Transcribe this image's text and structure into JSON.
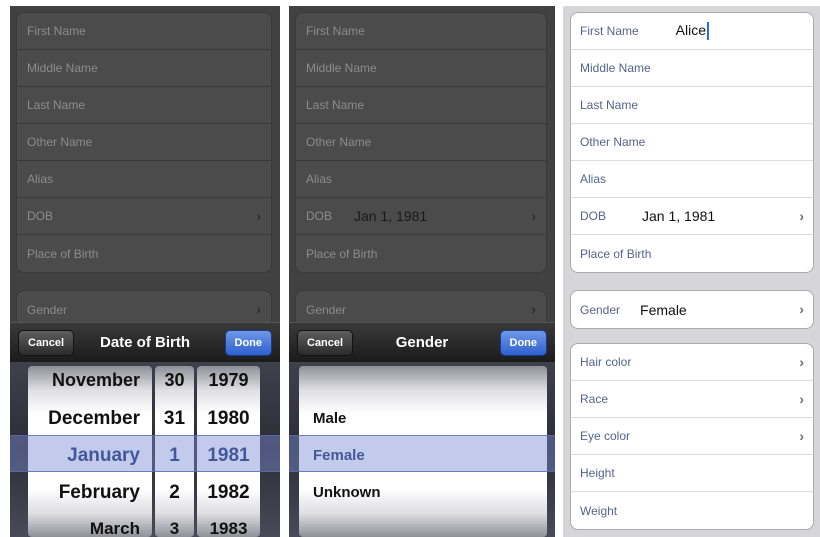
{
  "dob_screen": {
    "form": {
      "group1": [
        {
          "label": "First Name"
        },
        {
          "label": "Middle Name"
        },
        {
          "label": "Last Name"
        },
        {
          "label": "Other Name"
        },
        {
          "label": "Alias"
        },
        {
          "label": "DOB",
          "chevron": "chevron-right-icon"
        },
        {
          "label": "Place of Birth"
        }
      ],
      "gender_label": "Gender"
    },
    "toolbar": {
      "cancel": "Cancel",
      "title": "Date of Birth",
      "done": "Done"
    },
    "picker": {
      "months": [
        "November",
        "December",
        "January",
        "February",
        "March"
      ],
      "days": [
        "30",
        "31",
        "1",
        "2",
        "3"
      ],
      "years": [
        "1979",
        "1980",
        "1981",
        "1982",
        "1983"
      ],
      "selected_index": 2
    }
  },
  "gender_screen": {
    "form": {
      "group1": [
        {
          "label": "First Name"
        },
        {
          "label": "Middle Name"
        },
        {
          "label": "Last Name"
        },
        {
          "label": "Other Name"
        },
        {
          "label": "Alias"
        },
        {
          "label": "DOB",
          "value": "Jan 1, 1981",
          "chevron": "chevron-right-icon"
        },
        {
          "label": "Place of Birth"
        }
      ],
      "gender_label": "Gender"
    },
    "toolbar": {
      "cancel": "Cancel",
      "title": "Gender",
      "done": "Done"
    },
    "picker": {
      "options": [
        "Male",
        "Female",
        "Unknown"
      ],
      "selected_index": 1
    }
  },
  "form_screen": {
    "group1": [
      {
        "label": "First Name",
        "value": "Alice"
      },
      {
        "label": "Middle Name"
      },
      {
        "label": "Last Name"
      },
      {
        "label": "Other Name"
      },
      {
        "label": "Alias"
      },
      {
        "label": "DOB",
        "value": "Jan 1, 1981",
        "chevron": "chevron-right-icon"
      },
      {
        "label": "Place of Birth"
      }
    ],
    "group2": [
      {
        "label": "Gender",
        "value": "Female",
        "chevron": "chevron-right-icon"
      }
    ],
    "group3": [
      {
        "label": "Hair color",
        "chevron": "chevron-right-icon"
      },
      {
        "label": "Race",
        "chevron": "chevron-right-icon"
      },
      {
        "label": "Eye color",
        "chevron": "chevron-right-icon"
      },
      {
        "label": "Height"
      },
      {
        "label": "Weight"
      }
    ]
  },
  "colors": {
    "accent": "#2e60d0",
    "selection": "#7c8cd2",
    "label": "#53648a"
  }
}
